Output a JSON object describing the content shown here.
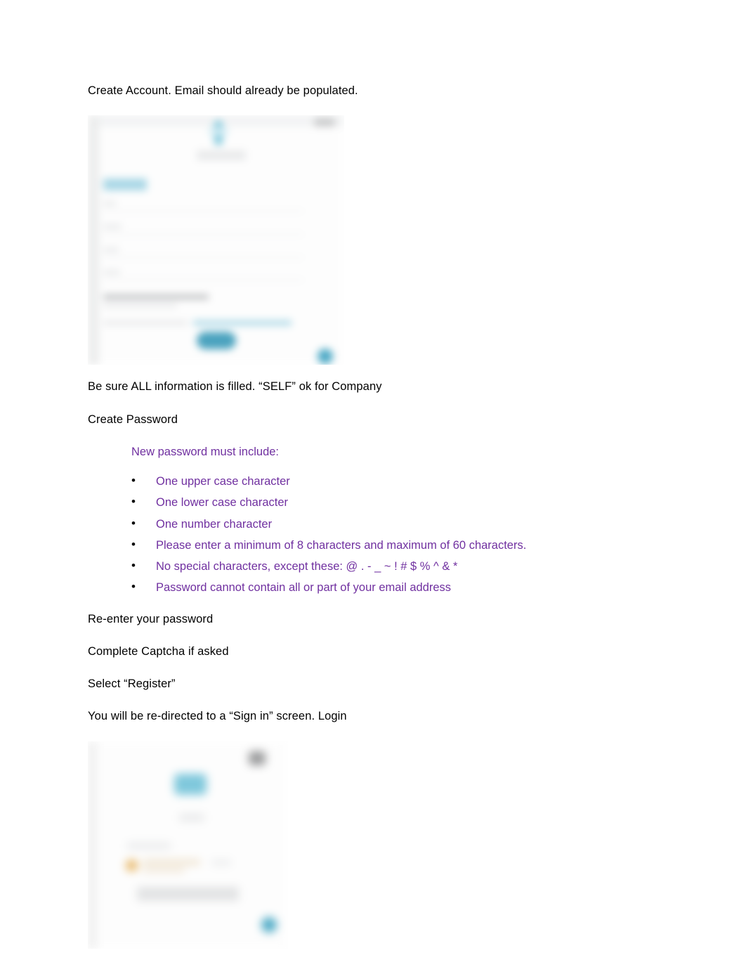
{
  "document": {
    "paragraphs": {
      "intro": "Create Account.  Email should already be populated.",
      "all_info": "Be sure ALL information is filled.  “SELF” ok for Company",
      "create_password": "Create Password",
      "reenter": "Re-enter your password",
      "captcha": "Complete Captcha if asked",
      "select_register": "Select “Register”",
      "redirect": "You will be re-directed to a “Sign in” screen.  Login"
    },
    "password_rules": {
      "heading": "New password must include:",
      "color": "#7030A0",
      "items": [
        "One upper case character",
        "One lower case character",
        "One number character",
        "Please enter a minimum of 8 characters and maximum of 60 characters.",
        "No special characters, except these: @ . - _ ~ ! # $ % ^ & *",
        "Password cannot contain all or part of your email address"
      ]
    },
    "figures": [
      {
        "name": "create-account-screenshot",
        "description": "Blurred screenshot of the Create Account registration form with logo header, form fields, consent checkboxes and a teal Register button.",
        "accent_color": "#4ba3bf"
      },
      {
        "name": "sign-in-screenshot",
        "description": "Blurred screenshot of the Sign in screen with teal logo, login heading, an amber alert, a gray input field and a teal circular help button.",
        "accent_color": "#4eaac6",
        "alert_color": "#e8b869"
      }
    ],
    "colors": {
      "text": "#000000",
      "purple": "#7030A0",
      "teal": "#4ba3bf",
      "page_background": "#ffffff"
    }
  }
}
